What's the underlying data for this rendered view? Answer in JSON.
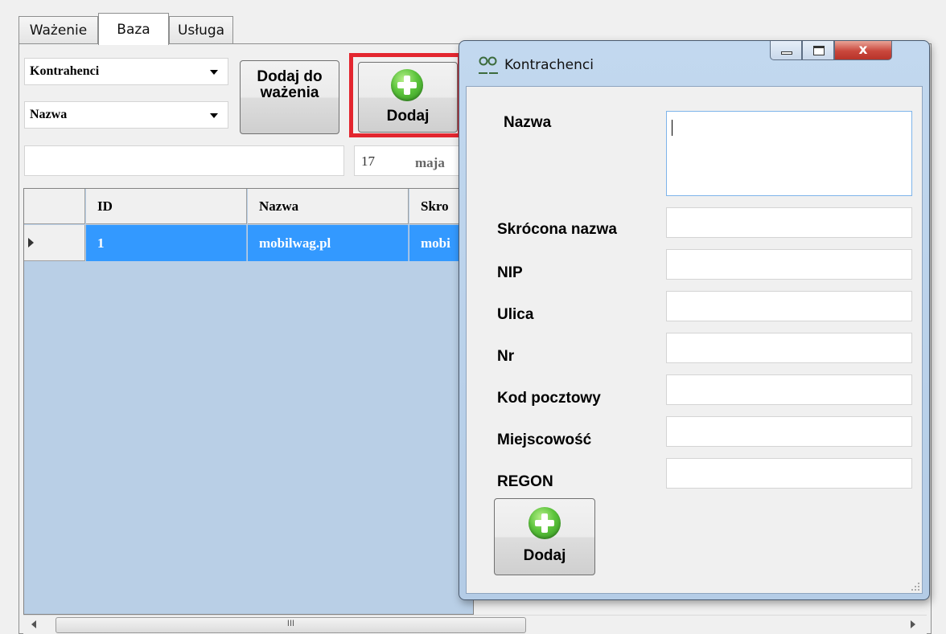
{
  "tabs": [
    "Ważenie",
    "Baza",
    "Usługa"
  ],
  "toolbar": {
    "combo_table": "Kontrahenci",
    "combo_field": "Nazwa",
    "add_to_weighing_label": "Dodaj do ważenia",
    "add_label": "Dodaj",
    "search_value": "",
    "date_day": "17",
    "date_month": "maja"
  },
  "grid": {
    "columns": [
      "ID",
      "Nazwa",
      "Skro"
    ],
    "rows": [
      {
        "id": "1",
        "nazwa": "mobilwag.pl",
        "skrot": "mobi"
      }
    ]
  },
  "scroll_grip": "III",
  "dialog": {
    "title": "Kontrachenci",
    "fields": [
      {
        "label": "Nazwa",
        "value": ""
      },
      {
        "label": "Skrócona nazwa",
        "value": ""
      },
      {
        "label": "NIP",
        "value": ""
      },
      {
        "label": "Ulica",
        "value": ""
      },
      {
        "label": "Nr",
        "value": ""
      },
      {
        "label": "Kod pocztowy",
        "value": ""
      },
      {
        "label": "Miejscowość",
        "value": ""
      },
      {
        "label": "REGON",
        "value": ""
      }
    ],
    "add_label": "Dodaj"
  },
  "colors": {
    "highlight": "#e3262f",
    "selected_row": "#3399ff",
    "grid_background": "#b9cfe6",
    "close_button": "#c9473c"
  },
  "icons": [
    "add-plus-icon",
    "dropdown-arrow-icon",
    "row-pointer-icon",
    "minimize-icon",
    "maximize-icon",
    "close-icon",
    "app-icon",
    "size-grip-icon"
  ]
}
